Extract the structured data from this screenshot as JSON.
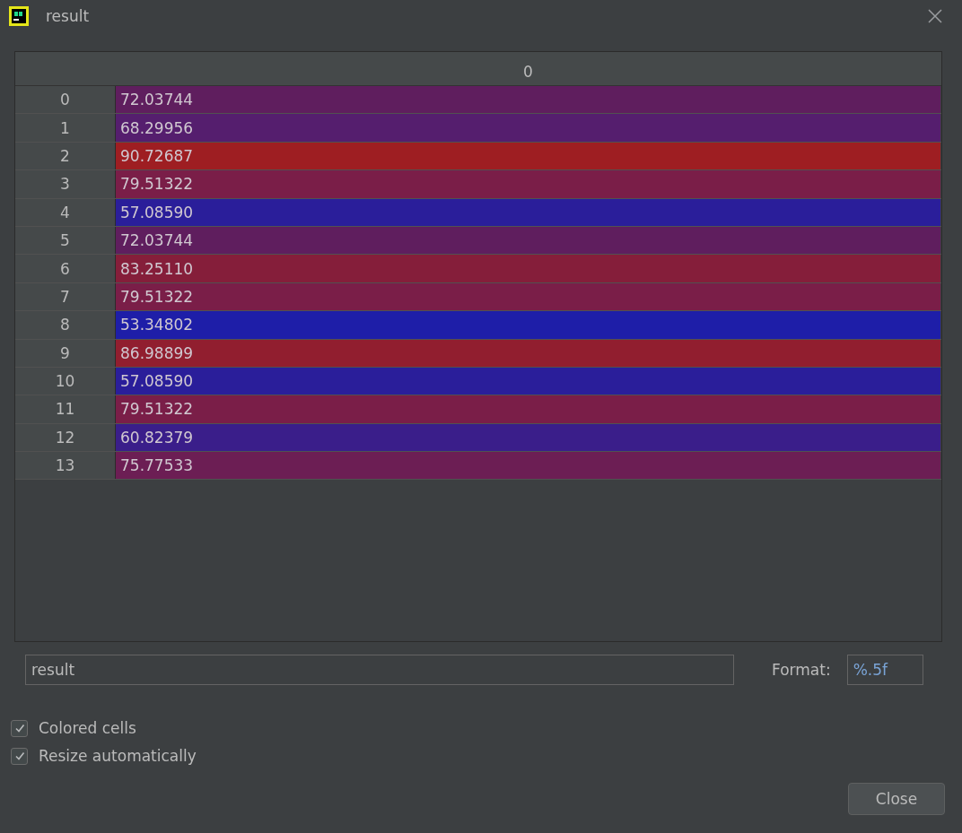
{
  "window": {
    "title": "result"
  },
  "table": {
    "columns": [
      "0"
    ],
    "rows": [
      {
        "index": "0",
        "value": "72.03744",
        "color": "#5f1e5e"
      },
      {
        "index": "1",
        "value": "68.29956",
        "color": "#551e6e"
      },
      {
        "index": "2",
        "value": "90.72687",
        "color": "#9e1e22"
      },
      {
        "index": "3",
        "value": "79.51322",
        "color": "#7a1e48"
      },
      {
        "index": "4",
        "value": "57.08590",
        "color": "#2a1e9a"
      },
      {
        "index": "5",
        "value": "72.03744",
        "color": "#5f1e5e"
      },
      {
        "index": "6",
        "value": "83.25110",
        "color": "#851e3a"
      },
      {
        "index": "7",
        "value": "79.51322",
        "color": "#7a1e48"
      },
      {
        "index": "8",
        "value": "53.34802",
        "color": "#1e1ea8"
      },
      {
        "index": "9",
        "value": "86.98899",
        "color": "#911e2f"
      },
      {
        "index": "10",
        "value": "57.08590",
        "color": "#2a1e9a"
      },
      {
        "index": "11",
        "value": "79.51322",
        "color": "#7a1e48"
      },
      {
        "index": "12",
        "value": "60.82379",
        "color": "#3a1e8a"
      },
      {
        "index": "13",
        "value": "75.77533",
        "color": "#6c1e54"
      }
    ]
  },
  "expression": {
    "value": "result"
  },
  "format": {
    "label": "Format:",
    "value": "%.5f"
  },
  "options": [
    {
      "label": "Colored cells",
      "checked": true
    },
    {
      "label": "Resize automatically",
      "checked": true
    }
  ],
  "buttons": [
    "Close"
  ]
}
